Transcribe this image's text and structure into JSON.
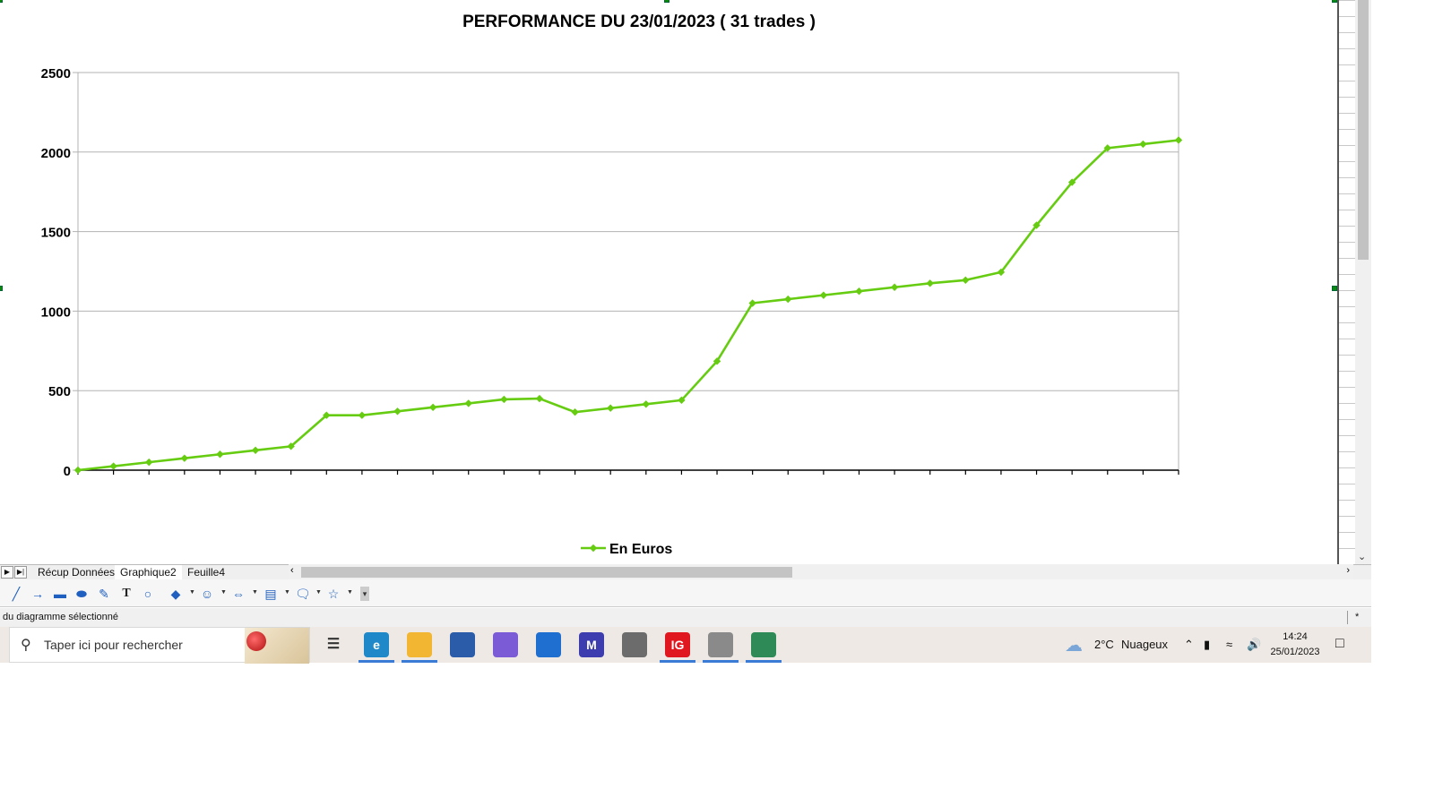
{
  "chart_data": {
    "type": "line",
    "title": "PERFORMANCE DU 23/01/2023 ( 31 trades )",
    "xlabel": "",
    "ylabel": "",
    "ylim": [
      0,
      2500
    ],
    "yticks": [
      "0",
      "500",
      "1000",
      "1500",
      "2000",
      "2500"
    ],
    "grid": true,
    "legend_position": "bottom",
    "series": [
      {
        "name": "En Euros",
        "color": "#66cc11",
        "values": [
          0,
          25,
          50,
          75,
          100,
          125,
          150,
          345,
          345,
          370,
          395,
          420,
          445,
          450,
          365,
          390,
          415,
          440,
          685,
          1050,
          1075,
          1100,
          1125,
          1150,
          1175,
          1195,
          1245,
          1540,
          1810,
          2025,
          2050,
          2075
        ]
      }
    ]
  },
  "sheet_tabs": {
    "tabs": [
      "Récup Données",
      "Graphique2",
      "Feuille4"
    ],
    "active": "Graphique2"
  },
  "drawing_toolbar": {
    "tools": [
      "line-icon",
      "arrow-icon",
      "rectangle-icon",
      "ellipse-icon",
      "freeform-icon",
      "text-icon",
      "callout-text-icon",
      "basic-shapes-icon",
      "symbol-shapes-icon",
      "block-arrows-icon",
      "flowchart-icon",
      "callouts-icon",
      "stars-icon"
    ]
  },
  "status_bar": {
    "text": "du diagramme sélectionné",
    "indicator": "*"
  },
  "taskbar": {
    "search_placeholder": "Taper ici pour rechercher",
    "weather_temp": "2°C",
    "weather_desc": "Nuageux",
    "time": "14:24",
    "date": "25/01/2023",
    "apps": [
      {
        "name": "task-view-icon",
        "label": "",
        "color": "#333333"
      },
      {
        "name": "edge-icon",
        "label": "e",
        "color": "#1e88c8"
      },
      {
        "name": "file-explorer-icon",
        "label": "",
        "color": "#f2b632"
      },
      {
        "name": "store-icon",
        "label": "",
        "color": "#2a5caa"
      },
      {
        "name": "copilot-icon",
        "label": "",
        "color": "#7b5bd6"
      },
      {
        "name": "mail-icon",
        "label": "",
        "color": "#1f6fd0"
      },
      {
        "name": "trading-app-icon",
        "label": "M",
        "color": "#3d3db0"
      },
      {
        "name": "calculator-icon",
        "label": "",
        "color": "#6c6c6c"
      },
      {
        "name": "ig-icon",
        "label": "IG",
        "color": "#e0171e"
      },
      {
        "name": "chart-app-icon",
        "label": "",
        "color": "#8a8a8a"
      },
      {
        "name": "calc-spreadsheet-icon",
        "label": "",
        "color": "#2e8b57"
      }
    ]
  }
}
